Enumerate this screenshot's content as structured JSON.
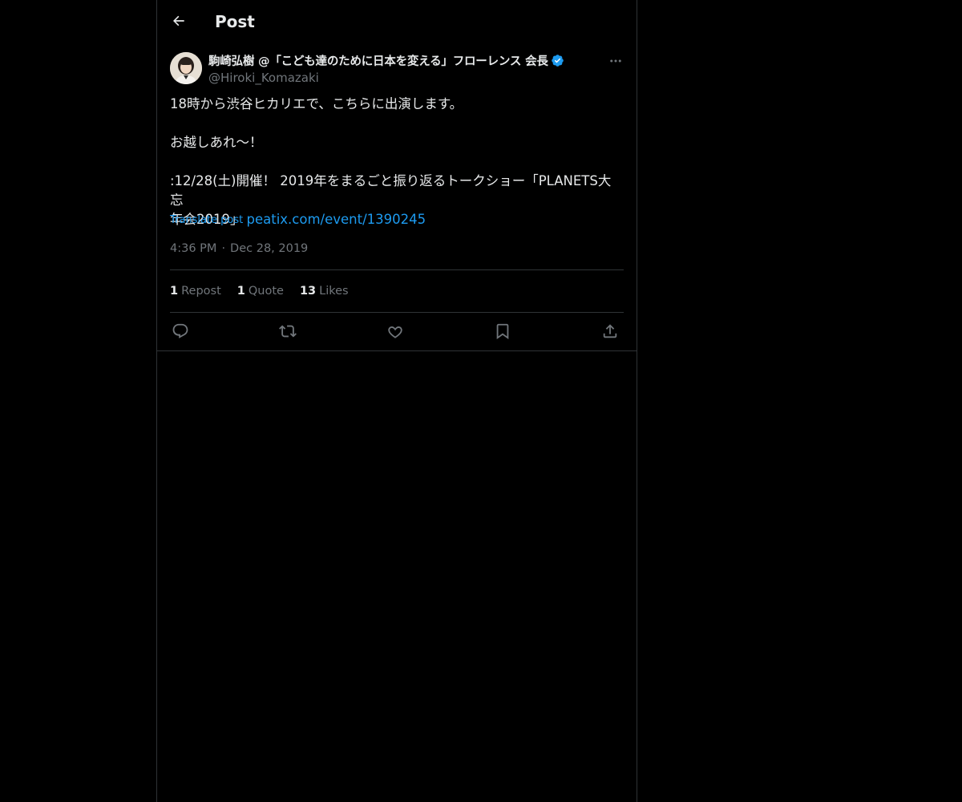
{
  "header": {
    "title": "Post"
  },
  "post": {
    "author": {
      "display_name": "駒崎弘樹 @「こども達のために日本を変える」フローレンス 会長",
      "handle": "@Hiroki_Komazaki",
      "verified": true
    },
    "text_lines": {
      "line1": "18時から渋谷ヒカリエで、こちらに出演します。",
      "line2": "お越しあれ〜！",
      "line3": ":12/28(土)開催！ 2019年をまるごと振り返るトークショー「PLANETS大忘",
      "line4": "年会2019」"
    },
    "link_text": "peatix.com/event/1390245",
    "translate_label": "Translate post",
    "time": "4:36 PM",
    "date": "Dec 28, 2019",
    "separator": "·"
  },
  "stats": {
    "reposts": {
      "count": "1",
      "label": "Repost"
    },
    "quotes": {
      "count": "1",
      "label": "Quote"
    },
    "likes": {
      "count": "13",
      "label": "Likes"
    }
  },
  "actions": {
    "icons": [
      "reply-icon",
      "repost-icon",
      "like-icon",
      "bookmark-icon",
      "share-icon"
    ]
  },
  "colors": {
    "background": "#000000",
    "text_primary": "#e7e9ea",
    "text_secondary": "#71767b",
    "accent": "#1d9bf0",
    "border": "#2f3336"
  }
}
